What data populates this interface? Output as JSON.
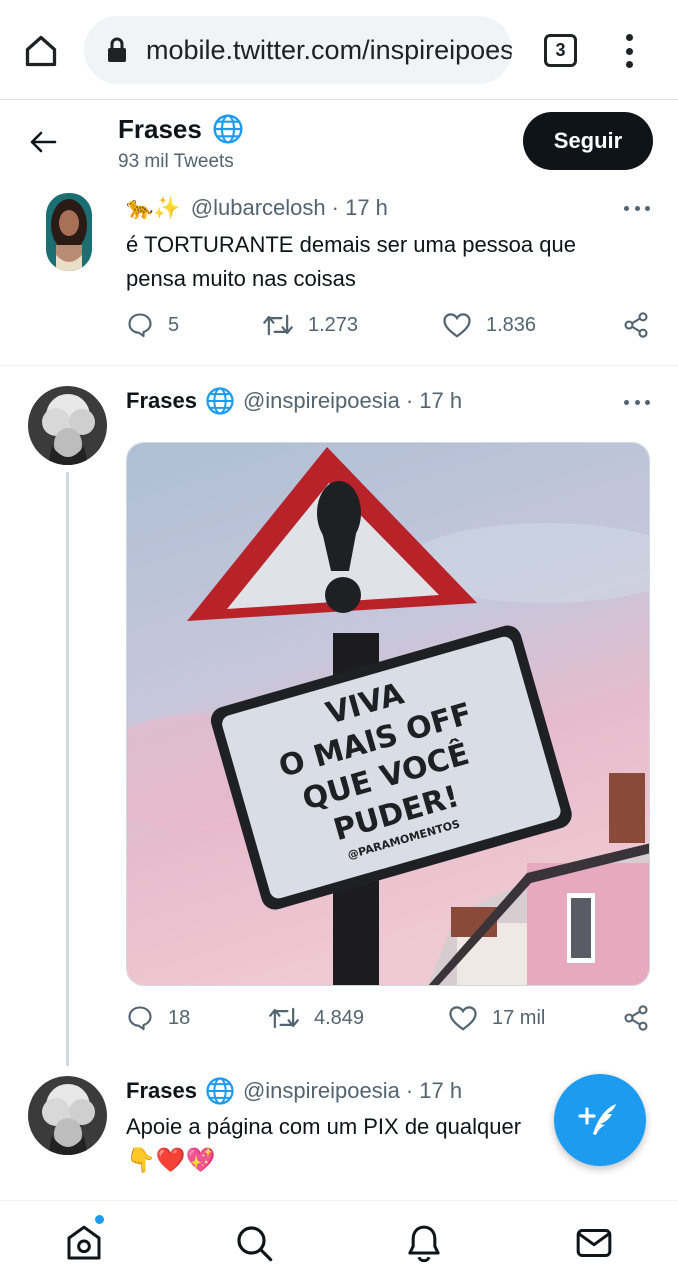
{
  "browser": {
    "url": "mobile.twitter.com/inspireipoesia",
    "tab_count": "3",
    "icons": [
      "home-icon",
      "lock-icon",
      "more-vert-icon"
    ]
  },
  "profile": {
    "name": "Frases",
    "tweet_count": "93 mil Tweets",
    "follow_label": "Seguir"
  },
  "tweets": [
    {
      "emoji": "🐆✨",
      "handle": "@lubarcelosh",
      "time": "· 17 h",
      "text": "é TORTURANTE demais ser uma pessoa que pensa muito nas coisas",
      "replies": "5",
      "retweets": "1.273",
      "likes": "1.836"
    },
    {
      "name": "Frases",
      "handle": "@inspireipoesia",
      "time": "· 17 h",
      "image_text": [
        "VIVA",
        "O MAIS OFF",
        "QUE VOCÊ",
        "PUDER!",
        "@PARAMOMENTOS"
      ],
      "replies": "18",
      "retweets": "4.849",
      "likes": "17 mil"
    },
    {
      "name": "Frases",
      "handle": "@inspireipoesia",
      "time": "· 17 h",
      "text": "Apoie a página com um PIX de qualquer",
      "emoji_line": "👇❤️💖"
    }
  ],
  "colors": {
    "accent": "#1d9bf0",
    "text": "#0f1419",
    "secondary": "#536471",
    "follow_bg": "#0f1419"
  },
  "nav": [
    "home-icon",
    "search-icon",
    "bell-icon",
    "mail-icon"
  ]
}
